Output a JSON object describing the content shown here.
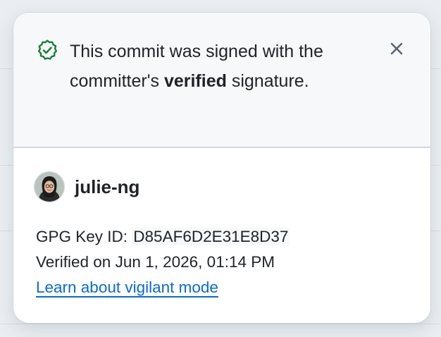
{
  "popover": {
    "header": {
      "text_before": "This commit was signed with the committer's ",
      "text_bold": "verified",
      "text_after": " signature."
    },
    "close_label": "Close",
    "user": {
      "username": "julie-ng"
    },
    "gpg": {
      "label": "GPG Key ID: ",
      "key_id": "D85AF6D2E31E8D37"
    },
    "verified": "Verified on Jun 1, 2026, 01:14 PM",
    "learn_link": "Learn about vigilant mode"
  },
  "colors": {
    "success_green": "#1a7f37",
    "link_blue": "#0969da",
    "header_bg": "#f6f8fa"
  },
  "icons": {
    "status": "verified-check-icon",
    "close": "close-x-icon"
  }
}
